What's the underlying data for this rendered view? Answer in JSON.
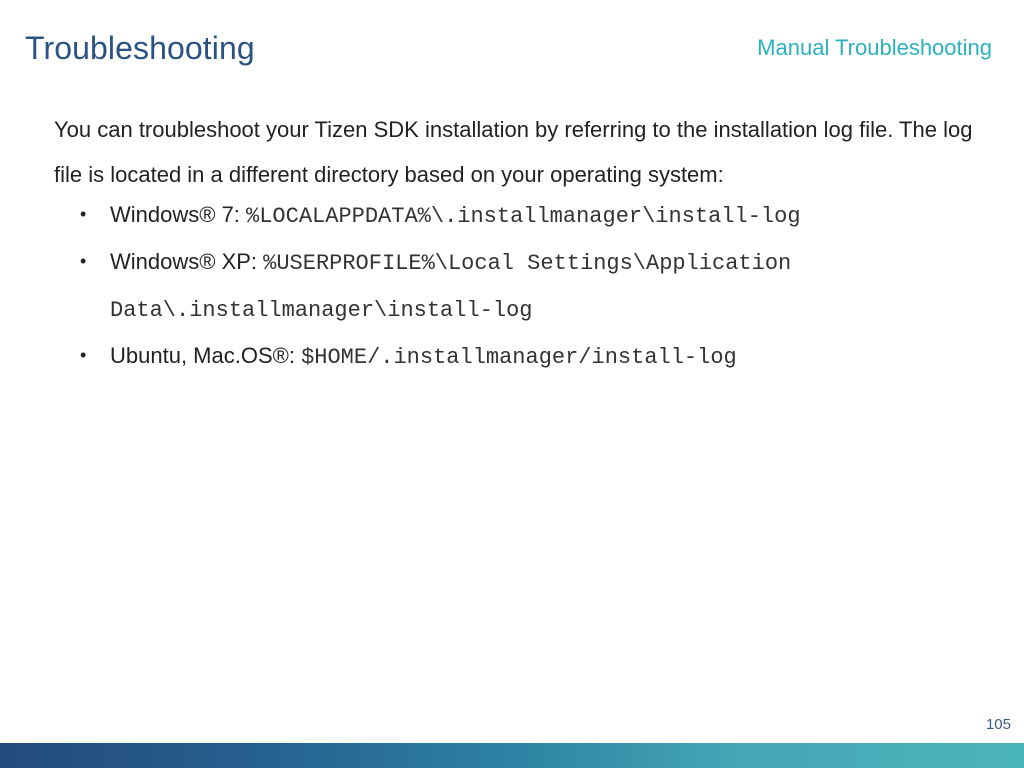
{
  "header": {
    "title": "Troubleshooting",
    "section": "Manual Troubleshooting"
  },
  "body": {
    "intro": "You can troubleshoot your Tizen SDK installation by referring to the installation log file. The log file is located in a different directory based on your operating system:",
    "bullets": [
      {
        "label": "Windows® 7: ",
        "path": "%LOCALAPPDATA%\\.installmanager\\install-log"
      },
      {
        "label": "Windows® XP: ",
        "path": "%USERPROFILE%\\Local Settings\\Application Data\\.installmanager\\install-log"
      },
      {
        "label": "Ubuntu, Mac.OS®: ",
        "path": "$HOME/.installmanager/install-log"
      }
    ],
    "bullet_glyph": "•"
  },
  "footer": {
    "page_number": "105"
  },
  "colors": {
    "title": "#2a5384",
    "section_title": "#2bb2bd",
    "body_text": "#222222",
    "footer_gradient_start": "#244a7a",
    "footer_gradient_end": "#4ab6bb"
  }
}
